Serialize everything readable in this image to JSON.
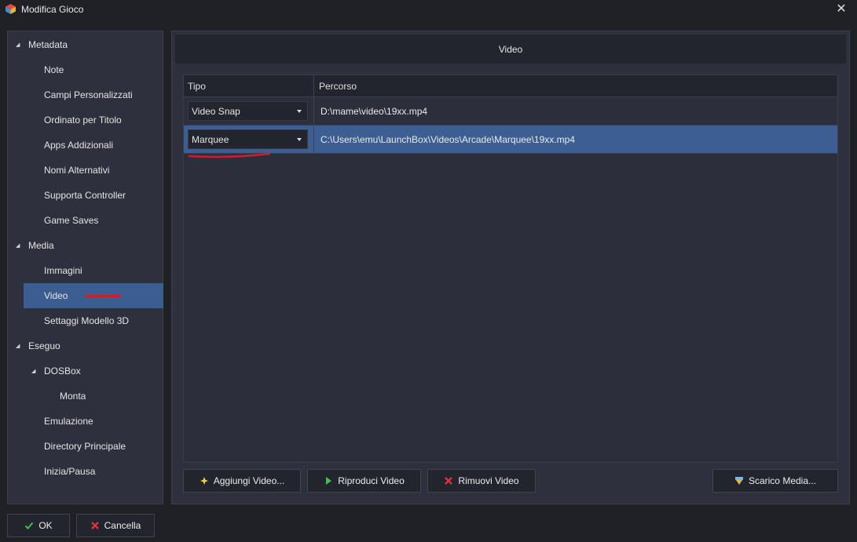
{
  "window": {
    "title": "Modifica Gioco"
  },
  "tree": {
    "items": [
      {
        "label": "Metadata",
        "level": 0,
        "expanded": true
      },
      {
        "label": "Note",
        "level": 1
      },
      {
        "label": "Campi Personalizzati",
        "level": 1
      },
      {
        "label": "Ordinato per Titolo",
        "level": 1
      },
      {
        "label": "Apps Addizionali",
        "level": 1
      },
      {
        "label": "Nomi Alternativi",
        "level": 1
      },
      {
        "label": "Supporta Controller",
        "level": 1
      },
      {
        "label": "Game Saves",
        "level": 1
      },
      {
        "label": "Media",
        "level": 0,
        "expanded": true
      },
      {
        "label": "Immagini",
        "level": 1
      },
      {
        "label": "Video",
        "level": 1,
        "selected": true
      },
      {
        "label": "Settaggi Modello 3D",
        "level": 1
      },
      {
        "label": "Eseguo",
        "level": 0,
        "expanded": true
      },
      {
        "label": "DOSBox",
        "level": 1,
        "expanded": true
      },
      {
        "label": "Monta",
        "level": 2
      },
      {
        "label": "Emulazione",
        "level": 1
      },
      {
        "label": "Directory Principale",
        "level": 1
      },
      {
        "label": "Inizia/Pausa",
        "level": 1
      }
    ]
  },
  "main": {
    "header": "Video",
    "columns": {
      "type": "Tipo",
      "path": "Percorso"
    },
    "rows": [
      {
        "type": "Video Snap",
        "path": "D:\\mame\\video\\19xx.mp4",
        "selected": false
      },
      {
        "type": "Marquee",
        "path": "C:\\Users\\emu\\LaunchBox\\Videos\\Arcade\\Marquee\\19xx.mp4",
        "selected": true
      }
    ],
    "buttons": {
      "add": "Aggiungi Video...",
      "play": "Riproduci Video",
      "remove": "Rimuovi Video",
      "download": "Scarico Media..."
    }
  },
  "footer": {
    "ok": "OK",
    "cancel": "Cancella"
  },
  "colors": {
    "accent": "#3c5d8f",
    "annotation": "#d21c2a"
  }
}
